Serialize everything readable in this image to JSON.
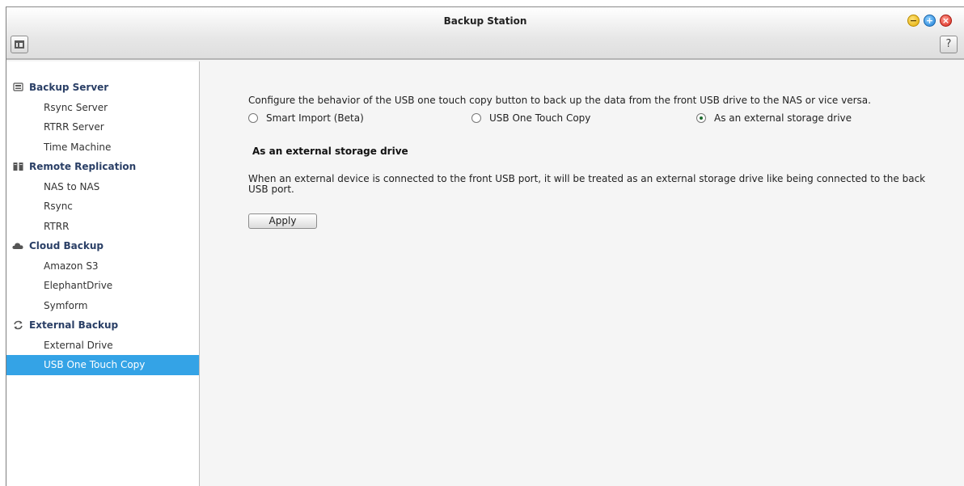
{
  "window": {
    "title": "Backup Station",
    "controls": {
      "minimize": "−",
      "maximize": "+",
      "close": "×"
    },
    "help_label": "?"
  },
  "sidebar": {
    "groups": [
      {
        "label": "Backup Server",
        "icon": "server-icon",
        "items": [
          {
            "label": "Rsync Server"
          },
          {
            "label": "RTRR Server"
          },
          {
            "label": "Time Machine"
          }
        ]
      },
      {
        "label": "Remote Replication",
        "icon": "replication-icon",
        "items": [
          {
            "label": "NAS to NAS"
          },
          {
            "label": "Rsync"
          },
          {
            "label": "RTRR"
          }
        ]
      },
      {
        "label": "Cloud Backup",
        "icon": "cloud-icon",
        "items": [
          {
            "label": "Amazon S3"
          },
          {
            "label": "ElephantDrive"
          },
          {
            "label": "Symform"
          }
        ]
      },
      {
        "label": "External Backup",
        "icon": "sync-icon",
        "items": [
          {
            "label": "External Drive"
          },
          {
            "label": "USB One Touch Copy",
            "selected": true
          }
        ]
      }
    ]
  },
  "main": {
    "description": "Configure the behavior of the USB one touch copy button to back up the data from the front USB drive to the NAS or vice versa.",
    "options": [
      {
        "label": "Smart Import (Beta)",
        "checked": false
      },
      {
        "label": "USB One Touch Copy",
        "checked": false
      },
      {
        "label": "As an external storage drive",
        "checked": true
      }
    ],
    "section_title": "As an external storage drive",
    "section_body": "When an external device is connected to the front USB port, it will be treated as an external storage drive like being connected to the back USB port.",
    "apply_label": "Apply"
  },
  "colors": {
    "selected_item_bg": "#34a3e6",
    "group_header_text": "#2a3f66"
  }
}
